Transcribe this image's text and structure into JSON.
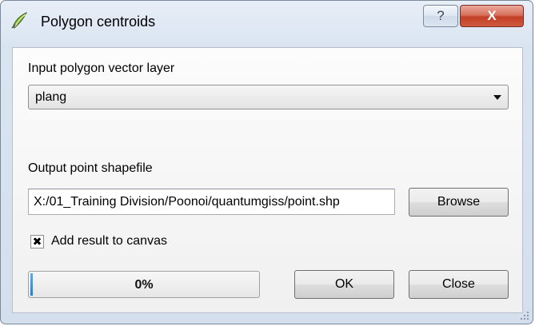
{
  "window": {
    "title": "Polygon centroids",
    "help_glyph": "?",
    "close_glyph": "X",
    "app_icon": "qgis-icon"
  },
  "form": {
    "input_label": "Input polygon vector layer",
    "input_layer_selected": "plang",
    "output_label": "Output point shapefile",
    "output_path": "X:/01_Training Division/Poonoi/quantumgiss/point.shp",
    "browse_label": "Browse",
    "add_to_canvas_label": "Add result to canvas",
    "add_to_canvas_checked": true,
    "checkbox_glyph": "✖"
  },
  "progress": {
    "value": 0,
    "text": "0%"
  },
  "buttons": {
    "ok_label": "OK",
    "close_label": "Close"
  }
}
